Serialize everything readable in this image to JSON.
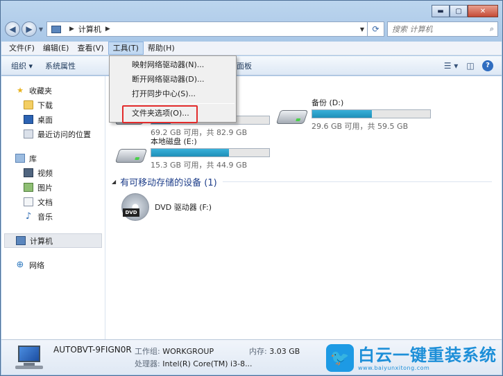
{
  "window": {
    "caption": {
      "minimize": "▬",
      "maximize": "▢",
      "close": "✕"
    }
  },
  "address": {
    "path": [
      "计算机"
    ],
    "search_placeholder": "搜索 计算机"
  },
  "menubar": {
    "items": [
      "文件(F)",
      "编辑(E)",
      "查看(V)",
      "工具(T)",
      "帮助(H)"
    ],
    "active": "工具(T)"
  },
  "toolbar": {
    "organize": "组织 ▾",
    "system_properties": "系统属性",
    "control_panel": "打开控制面板"
  },
  "tools_menu": {
    "items": [
      "映射网络驱动器(N)...",
      "断开网络驱动器(D)...",
      "打开同步中心(S)...",
      "文件夹选项(O)..."
    ],
    "highlighted": "文件夹选项(O)..."
  },
  "navpane": {
    "favorites": {
      "label": "收藏夹",
      "items": [
        "下载",
        "桌面",
        "最近访问的位置"
      ]
    },
    "libraries": {
      "label": "库",
      "items": [
        "视频",
        "图片",
        "文档",
        "音乐"
      ]
    },
    "computer": "计算机",
    "network": "网络"
  },
  "drives": [
    {
      "name": "",
      "free": "69.2 GB 可用，共 82.9 GB",
      "used_fraction": 0.165
    },
    {
      "name": "备份 (D:)",
      "free": "29.6 GB 可用，共 59.5 GB",
      "used_fraction": 0.503
    },
    {
      "name": "本地磁盘 (E:)",
      "free": "15.3 GB 可用，共 44.9 GB",
      "used_fraction": 0.659
    }
  ],
  "removable": {
    "heading": "有可移动存储的设备 (1)",
    "dvd": {
      "name": "DVD 驱动器 (F:)",
      "badge": "DVD"
    }
  },
  "details": {
    "computer_name": "AUTOBVT-9FIGN0R",
    "workgroup_label": "工作组:",
    "workgroup": "WORKGROUP",
    "memory_label": "内存:",
    "memory": "3.03 GB",
    "cpu_label": "处理器:",
    "cpu": "Intel(R) Core(TM) i3-8..."
  },
  "watermark": {
    "title": "白云一键重装系统",
    "url": "www.baiyunxitong.com"
  },
  "colors": {
    "bar_fill": "#1e8fb8",
    "highlight_box": "#e22b2b",
    "window_frame": "#a9c7e7"
  }
}
